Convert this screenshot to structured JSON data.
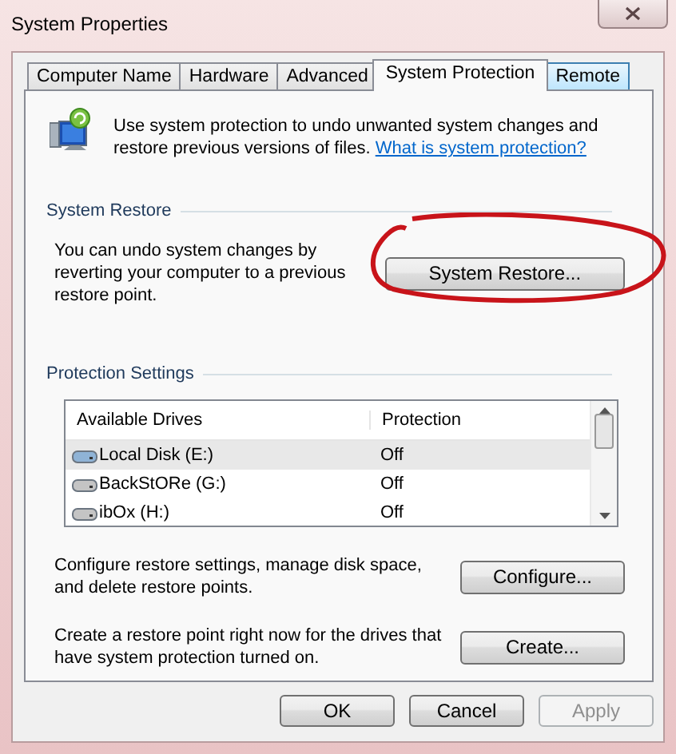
{
  "window": {
    "title": "System Properties"
  },
  "tabs": [
    {
      "label": "Computer Name",
      "selected": false,
      "hovered": false
    },
    {
      "label": "Hardware",
      "selected": false,
      "hovered": false
    },
    {
      "label": "Advanced",
      "selected": false,
      "hovered": false
    },
    {
      "label": "System Protection",
      "selected": true,
      "hovered": false
    },
    {
      "label": "Remote",
      "selected": false,
      "hovered": true
    }
  ],
  "intro": {
    "text": "Use system protection to undo unwanted system changes and restore previous versions of files.",
    "link": "What is system protection?"
  },
  "system_restore": {
    "heading": "System Restore",
    "text": "You can undo system changes by reverting your computer to a previous restore point.",
    "button": "System Restore..."
  },
  "protection_settings": {
    "heading": "Protection Settings",
    "columns": [
      "Available Drives",
      "Protection"
    ],
    "drives": [
      {
        "name": "Local Disk (E:)",
        "protection": "Off",
        "selected": true
      },
      {
        "name": "BackStORe (G:)",
        "protection": "Off",
        "selected": false
      },
      {
        "name": "ibOx (H:)",
        "protection": "Off",
        "selected": false
      }
    ]
  },
  "configure": {
    "text": "Configure restore settings, manage disk space, and delete restore points.",
    "button": "Configure..."
  },
  "create": {
    "text": "Create a restore point right now for the drives that have system protection turned on.",
    "button": "Create..."
  },
  "buttons": [
    {
      "label": "OK",
      "disabled": false
    },
    {
      "label": "Cancel",
      "disabled": false
    },
    {
      "label": "Apply",
      "disabled": true
    }
  ]
}
